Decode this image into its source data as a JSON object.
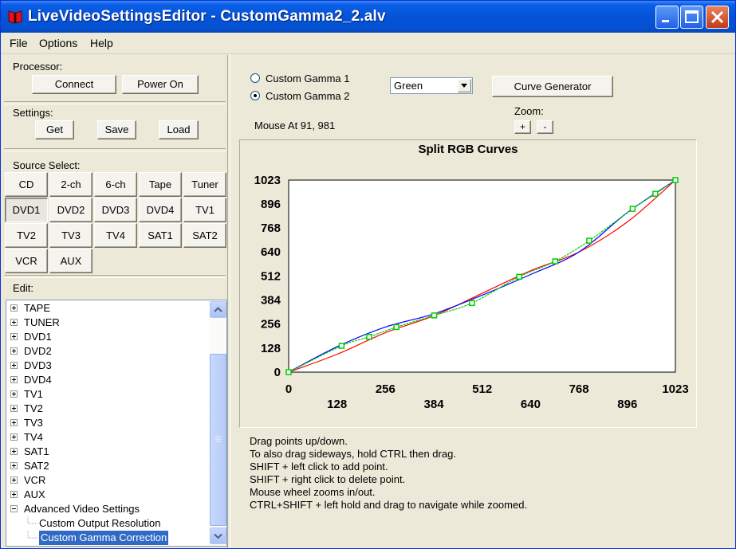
{
  "window": {
    "title": "LiveVideoSettingsEditor - CustomGamma2_2.alv"
  },
  "menu": [
    {
      "label": "File"
    },
    {
      "label": "Options"
    },
    {
      "label": "Help"
    }
  ],
  "processor": {
    "label": "Processor:",
    "connect": "Connect",
    "power_on": "Power On"
  },
  "settings": {
    "label": "Settings:",
    "get": "Get",
    "save": "Save",
    "load": "Load"
  },
  "source_select": {
    "label": "Source Select:",
    "buttons": [
      "CD",
      "2-ch",
      "6-ch",
      "Tape",
      "Tuner",
      "DVD1",
      "DVD2",
      "DVD3",
      "DVD4",
      "TV1",
      "TV2",
      "TV3",
      "TV4",
      "SAT1",
      "SAT2",
      "VCR",
      "AUX"
    ],
    "selected": "DVD1"
  },
  "edit": {
    "label": "Edit:",
    "tree": [
      {
        "label": "TAPE"
      },
      {
        "label": "TUNER"
      },
      {
        "label": "DVD1"
      },
      {
        "label": "DVD2"
      },
      {
        "label": "DVD3"
      },
      {
        "label": "DVD4"
      },
      {
        "label": "TV1"
      },
      {
        "label": "TV2"
      },
      {
        "label": "TV3"
      },
      {
        "label": "TV4"
      },
      {
        "label": "SAT1"
      },
      {
        "label": "SAT2"
      },
      {
        "label": "VCR"
      },
      {
        "label": "AUX"
      },
      {
        "label": "Advanced Video Settings"
      },
      {
        "label": "Custom Output Resolution"
      },
      {
        "label": "Custom Gamma Correction"
      }
    ],
    "selected": "Custom Gamma Correction"
  },
  "gamma": {
    "option1": "Custom Gamma 1",
    "option2": "Custom Gamma 2",
    "selected": "Custom Gamma 2"
  },
  "channel_select": {
    "value": "Green"
  },
  "curve_generator": "Curve Generator",
  "zoom": {
    "label": "Zoom:",
    "plus": "+",
    "minus": "-"
  },
  "mouse_status": "Mouse At 91, 981",
  "chart_data": {
    "type": "line",
    "title": "Split RGB Curves",
    "xlabel": "",
    "ylabel": "",
    "xlim": [
      0,
      1023
    ],
    "ylim": [
      0,
      1023
    ],
    "x_ticks": [
      0,
      128,
      256,
      384,
      512,
      640,
      768,
      896,
      1023
    ],
    "y_ticks": [
      0,
      128,
      256,
      384,
      512,
      640,
      768,
      896,
      1023
    ],
    "grid": false,
    "series": [
      {
        "color": "#ff0000",
        "x": [
          0,
          128,
          256,
          384,
          512,
          640,
          768,
          896,
          1023
        ],
        "y": [
          0,
          95,
          210,
          300,
          420,
          540,
          640,
          800,
          1023
        ]
      },
      {
        "color": "#0000ff",
        "x": [
          0,
          128,
          256,
          384,
          512,
          640,
          768,
          896,
          1023
        ],
        "y": [
          0,
          135,
          240,
          310,
          410,
          520,
          640,
          850,
          1023
        ]
      },
      {
        "color": "#00cc00",
        "points": true,
        "x": [
          0,
          140,
          213,
          285,
          385,
          485,
          610,
          705,
          795,
          910,
          970,
          1023
        ],
        "y": [
          0,
          140,
          188,
          240,
          302,
          368,
          508,
          590,
          700,
          870,
          950,
          1023
        ]
      }
    ]
  },
  "instructions": [
    "Drag points up/down.",
    "To also drag sideways, hold CTRL then drag.",
    "SHIFT + left click to add point.",
    "SHIFT + right click to delete point.",
    "Mouse wheel zooms in/out.",
    "CTRL+SHIFT + left hold and drag to navigate while zoomed."
  ],
  "colors": {
    "title_bar": "#0553d8",
    "selection": "#316ac5",
    "window_bg": "#ece9d8"
  }
}
